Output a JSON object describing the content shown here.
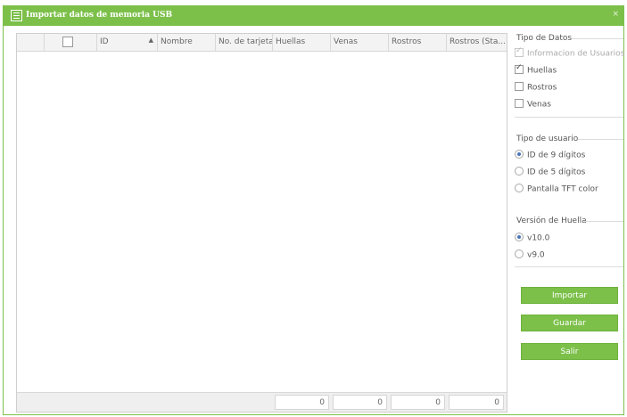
{
  "window": {
    "title": "Importar datos de memoria USB",
    "close_glyph": "×",
    "icon": "usb-document-icon"
  },
  "grid": {
    "columns": [
      {
        "label": "",
        "type": "rownum"
      },
      {
        "label": "",
        "type": "checkbox"
      },
      {
        "label": "ID",
        "sort": "▲"
      },
      {
        "label": "Nombre"
      },
      {
        "label": "No. de tarjeta"
      },
      {
        "label": "Huellas"
      },
      {
        "label": "Venas"
      },
      {
        "label": "Rostros"
      },
      {
        "label": "Rostros (Sta..."
      }
    ],
    "rows": [],
    "footer": {
      "huellas_total": "0",
      "venas_total": "0",
      "rostros_total": "0",
      "rostros_sta_total": "0"
    }
  },
  "panel": {
    "tipo_datos": {
      "title": "Tipo de Datos",
      "options": [
        {
          "label": "Informacion de Usuarios",
          "checked": true,
          "disabled": true
        },
        {
          "label": "Huellas",
          "checked": true,
          "disabled": false
        },
        {
          "label": "Rostros",
          "checked": false,
          "disabled": false
        },
        {
          "label": "Venas",
          "checked": false,
          "disabled": false
        }
      ]
    },
    "tipo_usuario": {
      "title": "Tipo de usuario",
      "options": [
        {
          "label": "ID de 9 dígitos",
          "selected": true
        },
        {
          "label": "ID de 5 dígitos",
          "selected": false
        },
        {
          "label": "Pantalla TFT color",
          "selected": false
        }
      ]
    },
    "version_huella": {
      "title": "Versión de Huella",
      "options": [
        {
          "label": "v10.0",
          "selected": true
        },
        {
          "label": "v9.0",
          "selected": false
        }
      ]
    },
    "buttons": {
      "importar": "Importar",
      "guardar": "Guardar",
      "salir": "Salir"
    }
  },
  "colors": {
    "accent": "#7cc04a",
    "radio_dot": "#4a76b8"
  }
}
